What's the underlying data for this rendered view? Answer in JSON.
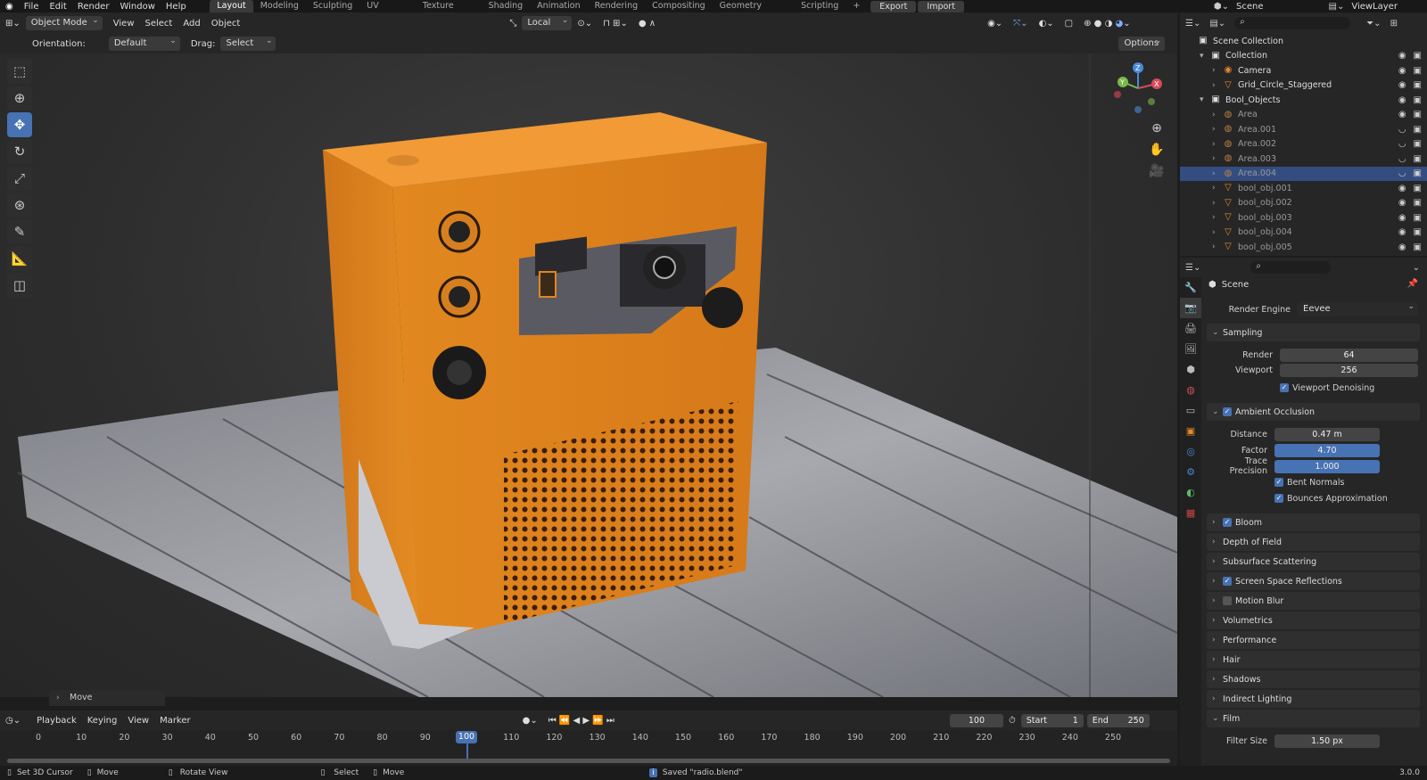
{
  "topbar": {
    "menus": [
      "File",
      "Edit",
      "Render",
      "Window",
      "Help"
    ],
    "workspaces": [
      "Layout",
      "Modeling",
      "Sculpting",
      "UV Editing",
      "Texture Paint",
      "Shading",
      "Animation",
      "Rendering",
      "Compositing",
      "Geometry Nodes",
      "Scripting"
    ],
    "active_workspace": "Layout",
    "add_tab": "+",
    "export_label": "Export",
    "import_label": "Import",
    "scene": "Scene",
    "view_layer": "ViewLayer"
  },
  "viewport_header": {
    "mode": "Object Mode",
    "menus": [
      "View",
      "Select",
      "Add",
      "Object"
    ],
    "transform_orientation": "Local",
    "orientation_label": "Orientation:",
    "orientation_value": "Default",
    "drag_label": "Drag:",
    "drag_value": "Select Box",
    "options": "Options"
  },
  "last_operator": "Move",
  "gizmo": {
    "x": "X",
    "y": "Y",
    "z": "Z"
  },
  "timeline": {
    "menus": [
      "Playback",
      "Keying",
      "View",
      "Marker"
    ],
    "current_frame": "100",
    "start_label": "Start",
    "start": "1",
    "end_label": "End",
    "end": "250",
    "ticks": [
      "0",
      "10",
      "20",
      "30",
      "40",
      "50",
      "60",
      "70",
      "80",
      "90",
      "100",
      "110",
      "120",
      "130",
      "140",
      "150",
      "160",
      "170",
      "180",
      "190",
      "200",
      "210",
      "220",
      "230",
      "240",
      "250"
    ]
  },
  "statusbar": {
    "items": [
      "Set 3D Cursor",
      "Move",
      "Rotate View",
      "Select",
      "Move"
    ],
    "message": "Saved \"radio.blend\"",
    "version": "3.0.0"
  },
  "outliner": {
    "rows": [
      {
        "label": "Scene Collection",
        "indent": 0,
        "icon": "scene-collection-icon",
        "glyph": "▣"
      },
      {
        "label": "Collection",
        "indent": 1,
        "icon": "collection-icon",
        "glyph": "▣"
      },
      {
        "label": "Camera",
        "indent": 2,
        "icon": "camera-icon",
        "glyph": "◉"
      },
      {
        "label": "Grid_Circle_Staggered",
        "indent": 2,
        "icon": "mesh-icon",
        "glyph": "▽"
      },
      {
        "label": "Bool_Objects",
        "indent": 1,
        "icon": "collection-icon",
        "glyph": "▣"
      },
      {
        "label": "Area",
        "indent": 2,
        "icon": "light-icon",
        "glyph": "◍"
      },
      {
        "label": "Area.001",
        "indent": 2,
        "icon": "light-icon",
        "glyph": "◍"
      },
      {
        "label": "Area.002",
        "indent": 2,
        "icon": "light-icon",
        "glyph": "◍"
      },
      {
        "label": "Area.003",
        "indent": 2,
        "icon": "light-icon",
        "glyph": "◍"
      },
      {
        "label": "Area.004",
        "indent": 2,
        "icon": "light-icon",
        "glyph": "◍"
      },
      {
        "label": "bool_obj.001",
        "indent": 2,
        "icon": "mesh-icon",
        "glyph": "▽"
      },
      {
        "label": "bool_obj.002",
        "indent": 2,
        "icon": "mesh-icon",
        "glyph": "▽"
      },
      {
        "label": "bool_obj.003",
        "indent": 2,
        "icon": "mesh-icon",
        "glyph": "▽"
      },
      {
        "label": "bool_obj.004",
        "indent": 2,
        "icon": "mesh-icon",
        "glyph": "▽"
      },
      {
        "label": "bool_obj.005",
        "indent": 2,
        "icon": "mesh-icon",
        "glyph": "▽"
      }
    ],
    "selected": "Area.004"
  },
  "properties": {
    "context": "Scene",
    "render_engine_label": "Render Engine",
    "render_engine": "Eevee",
    "sampling": {
      "title": "Sampling",
      "render_label": "Render",
      "render": "64",
      "viewport_label": "Viewport",
      "viewport": "256",
      "denoise_label": "Viewport Denoising"
    },
    "ao": {
      "title": "Ambient Occlusion",
      "distance_label": "Distance",
      "distance": "0.47 m",
      "factor_label": "Factor",
      "factor": "4.70",
      "trace_label": "Trace Precision",
      "trace": "1.000",
      "bent_label": "Bent Normals",
      "bounces_label": "Bounces Approximation"
    },
    "sections": [
      "Bloom",
      "Depth of Field",
      "Subsurface Scattering",
      "Screen Space Reflections",
      "Motion Blur",
      "Volumetrics",
      "Performance",
      "Hair",
      "Shadows",
      "Indirect Lighting"
    ],
    "film": {
      "title": "Film",
      "filter_label": "Filter Size",
      "filter": "1.50 px"
    }
  },
  "colors": {
    "accent": "#4772b3",
    "radio": "#e88a1e",
    "wood": "#8d8f95"
  }
}
